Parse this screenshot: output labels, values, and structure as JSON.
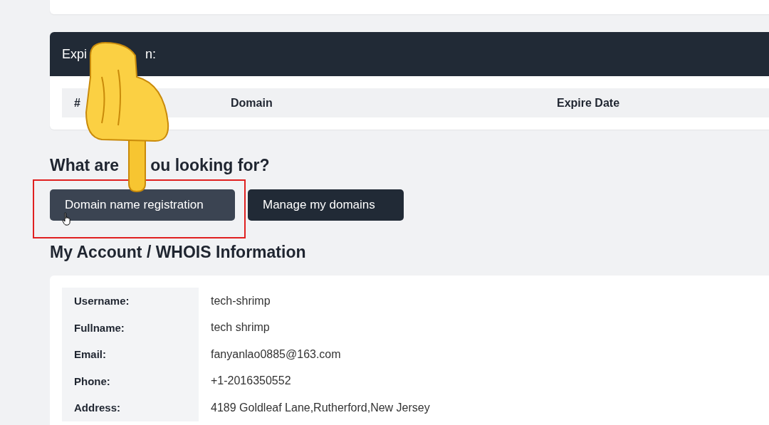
{
  "expiration_card": {
    "title_parts": [
      "Expi",
      "n:"
    ],
    "columns": [
      "#",
      "Domain",
      "Expire Date"
    ]
  },
  "search_section": {
    "heading_parts": [
      "What are",
      "ou looking for?"
    ],
    "buttons": [
      {
        "label": "Domain name registration",
        "hovered": true
      },
      {
        "label": "Manage my domains",
        "hovered": false
      }
    ]
  },
  "account": {
    "heading": "My Account / WHOIS Information",
    "rows": [
      {
        "label": "Username:",
        "value": "tech-shrimp"
      },
      {
        "label": "Fullname:",
        "value": "tech shrimp"
      },
      {
        "label": "Email:",
        "value": "fanyanlao0885@163.com"
      },
      {
        "label": "Phone:",
        "value": "+1-2016350552"
      },
      {
        "label": "Address:",
        "value": "4189 Goldleaf Lane,Rutherford,New Jersey"
      }
    ]
  }
}
